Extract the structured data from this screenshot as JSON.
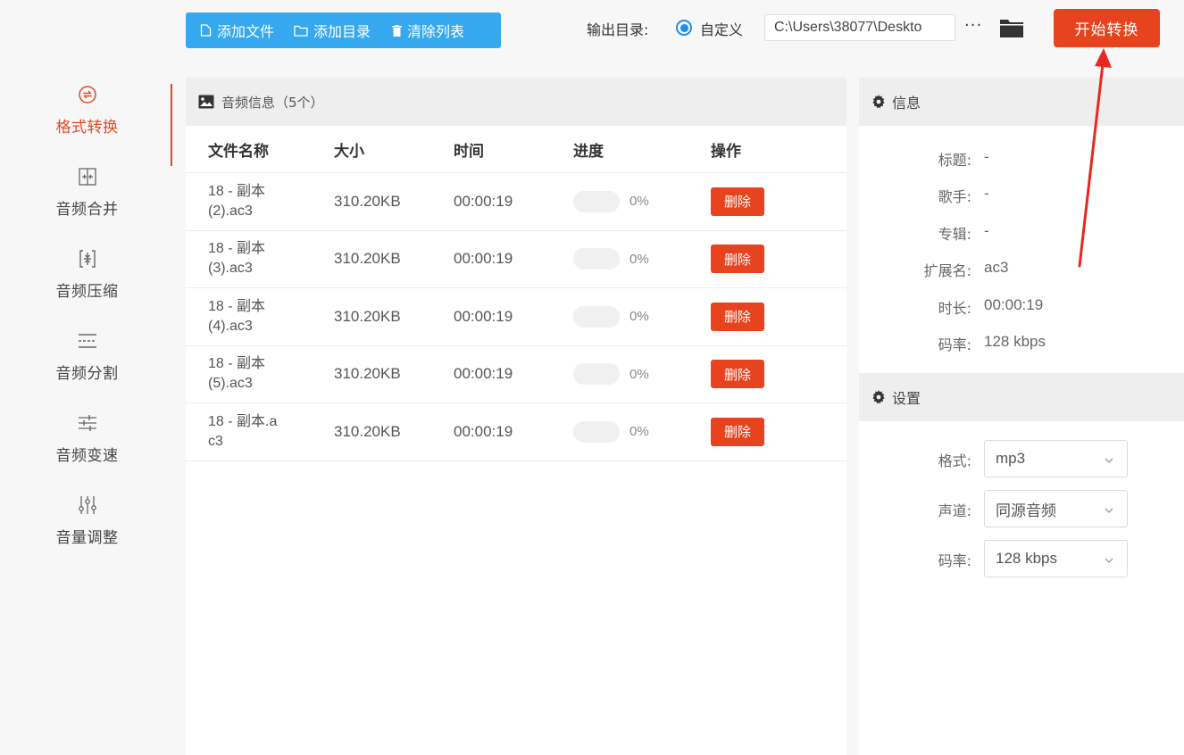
{
  "sidebar": {
    "items": [
      {
        "label": "格式转换",
        "icon": "format-convert-icon",
        "active": true
      },
      {
        "label": "音频合并",
        "icon": "merge-icon",
        "active": false
      },
      {
        "label": "音频压缩",
        "icon": "compress-icon",
        "active": false
      },
      {
        "label": "音频分割",
        "icon": "split-icon",
        "active": false
      },
      {
        "label": "音频变速",
        "icon": "speed-icon",
        "active": false
      },
      {
        "label": "音量调整",
        "icon": "volume-sliders-icon",
        "active": false
      }
    ]
  },
  "toolbar": {
    "add_file": "添加文件",
    "add_dir": "添加目录",
    "clear_list": "清除列表",
    "output_label": "输出目录:",
    "radio_label": "自定义",
    "output_path": "C:\\Users\\38077\\Deskto",
    "more": "···",
    "start": "开始转换"
  },
  "file_panel": {
    "title": "音频信息（5个）",
    "columns": {
      "name": "文件名称",
      "size": "大小",
      "time": "时间",
      "progress": "进度",
      "action": "操作"
    },
    "rows": [
      {
        "name_line1": "18 - 副本",
        "name_line2": "(2).ac3",
        "size": "310.20KB",
        "time": "00:00:19",
        "progress": 0,
        "progress_text": "0%",
        "action": "删除"
      },
      {
        "name_line1": "18 - 副本",
        "name_line2": "(3).ac3",
        "size": "310.20KB",
        "time": "00:00:19",
        "progress": 0,
        "progress_text": "0%",
        "action": "删除"
      },
      {
        "name_line1": "18 - 副本",
        "name_line2": "(4).ac3",
        "size": "310.20KB",
        "time": "00:00:19",
        "progress": 0,
        "progress_text": "0%",
        "action": "删除"
      },
      {
        "name_line1": "18 - 副本",
        "name_line2": "(5).ac3",
        "size": "310.20KB",
        "time": "00:00:19",
        "progress": 0,
        "progress_text": "0%",
        "action": "删除"
      },
      {
        "name_line1": "18 - 副本.a",
        "name_line2": "c3",
        "size": "310.20KB",
        "time": "00:00:19",
        "progress": 0,
        "progress_text": "0%",
        "action": "删除"
      }
    ]
  },
  "info": {
    "title": "信息",
    "rows": [
      {
        "key": "标题:",
        "value": "-"
      },
      {
        "key": "歌手:",
        "value": "-"
      },
      {
        "key": "专辑:",
        "value": "-"
      },
      {
        "key": "扩展名:",
        "value": "ac3"
      },
      {
        "key": "时长:",
        "value": "00:00:19"
      },
      {
        "key": "码率:",
        "value": "128 kbps"
      }
    ]
  },
  "settings": {
    "title": "设置",
    "rows": [
      {
        "key": "格式:",
        "value": "mp3"
      },
      {
        "key": "声道:",
        "value": "同源音频"
      },
      {
        "key": "码率:",
        "value": "128 kbps"
      }
    ]
  },
  "colors": {
    "accent": "#e8431f",
    "toolbar_blue": "#35a8f0",
    "radio_blue": "#1e8ff0",
    "annotation_red": "#e8281f"
  }
}
